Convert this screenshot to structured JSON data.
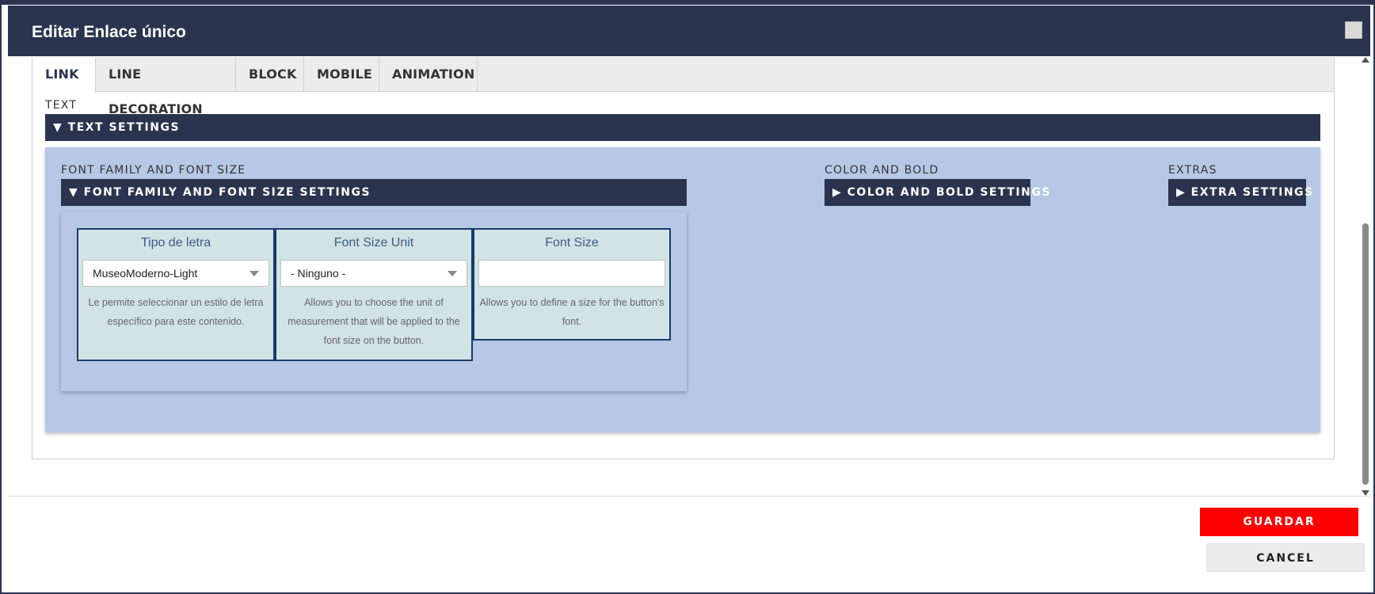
{
  "dialog": {
    "title": "Editar Enlace único"
  },
  "tabs": [
    {
      "label": "LINK",
      "active": true
    },
    {
      "label": "LINE DECORATION",
      "active": false
    },
    {
      "label": "BLOCK",
      "active": false
    },
    {
      "label": "MOBILE",
      "active": false
    },
    {
      "label": "ANIMATION",
      "active": false
    }
  ],
  "text_section": {
    "label": "TEXT",
    "bar_label": "▼ TEXT SETTINGS"
  },
  "font_group": {
    "label": "FONT FAMILY AND FONT SIZE",
    "bar_label": "▼ FONT FAMILY AND FONT SIZE SETTINGS"
  },
  "color_group": {
    "label": "COLOR AND BOLD",
    "bar_label": "▶ COLOR AND BOLD SETTINGS"
  },
  "extras_group": {
    "label": "EXTRAS",
    "bar_label": "▶ EXTRA SETTINGS"
  },
  "fields": {
    "font_family": {
      "label": "Tipo de letra",
      "value": "MuseoModerno-Light",
      "help": "Le permite seleccionar un estilo de letra específico para este contenido."
    },
    "font_size_unit": {
      "label": "Font Size Unit",
      "value": "- Ninguno -",
      "help": "Allows you to choose the unit of measurement that will be applied to the font size on the button."
    },
    "font_size": {
      "label": "Font Size",
      "value": "",
      "help": "Allows you to define a size for the button's font."
    }
  },
  "buttons": {
    "save": "GUARDAR",
    "cancel": "CANCEL"
  },
  "colors": {
    "header": "#2a344f",
    "panel": "#b7c8e6",
    "card": "#d2e3e5",
    "save": "#ff0000"
  }
}
